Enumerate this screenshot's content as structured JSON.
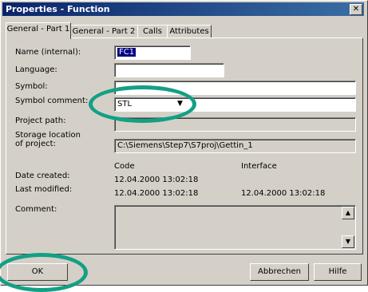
{
  "window": {
    "title": "Properties - Function",
    "close_glyph": "✕"
  },
  "tabs": [
    {
      "label": "General - Part 1",
      "active": true
    },
    {
      "label": "General - Part 2"
    },
    {
      "label": "Calls"
    },
    {
      "label": "Attributes"
    }
  ],
  "fields": {
    "name_label": "Name (internal):",
    "name_value": "FC1",
    "language_label": "Language:",
    "language_value": "",
    "symbol_label": "Symbol:",
    "symbol_value": "",
    "symbol_comment_label": "Symbol comment:",
    "symbol_comment_value": "STL",
    "project_path_label": "Project path:",
    "project_path_value": "",
    "storage_label_1": "Storage location",
    "storage_label_2": "of project:",
    "storage_value": "C:\\Siemens\\Step7\\S7proj\\Gettin_1"
  },
  "info": {
    "code_header": "Code",
    "interface_header": "Interface",
    "date_created_label": "Date created:",
    "date_created_code": "12.04.2000  13:02:18",
    "last_modified_label": "Last modified:",
    "last_modified_code": "12.04.2000  13:02:18",
    "last_modified_interface": "12.04.2000  13:02:18"
  },
  "comment": {
    "label": "Comment:",
    "value": ""
  },
  "buttons": {
    "ok": "OK",
    "cancel": "Abbrechen",
    "help": "Hilfe"
  },
  "colors": {
    "annotation_circle": "#13a085",
    "titlebar": "#0a246a"
  }
}
